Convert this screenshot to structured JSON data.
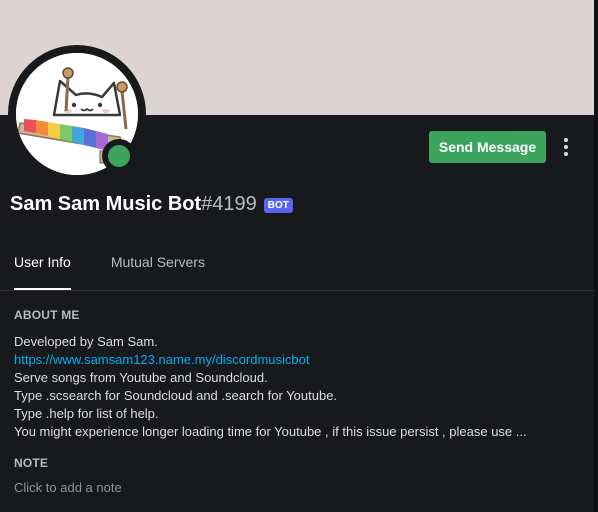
{
  "banner_color": "#dcd3d2",
  "accent_color": "#3ba55d",
  "bot_tag_color": "#5865f2",
  "avatar": {
    "icon": "cat-playing-xylophone-icon"
  },
  "status": "online",
  "header": {
    "send_message_label": "Send Message",
    "more_icon": "more-vertical-icon"
  },
  "user": {
    "username": "Sam Sam Music Bot",
    "discriminator": "#4199",
    "bot_tag": "BOT"
  },
  "tabs": [
    {
      "label": "User Info",
      "active": true
    },
    {
      "label": "Mutual Servers",
      "active": false
    }
  ],
  "about": {
    "title": "About Me",
    "lines": [
      "Developed by Sam Sam.",
      "https://www.samsam123.name.my/discordmusicbot",
      "Serve songs from Youtube and Soundcloud.",
      "Type .scsearch for Soundcloud and .search for Youtube.",
      "Type .help for list of help.",
      "You might experience longer loading time for Youtube , if this issue persist , please use ..."
    ]
  },
  "note": {
    "title": "Note",
    "placeholder": "Click to add a note"
  }
}
